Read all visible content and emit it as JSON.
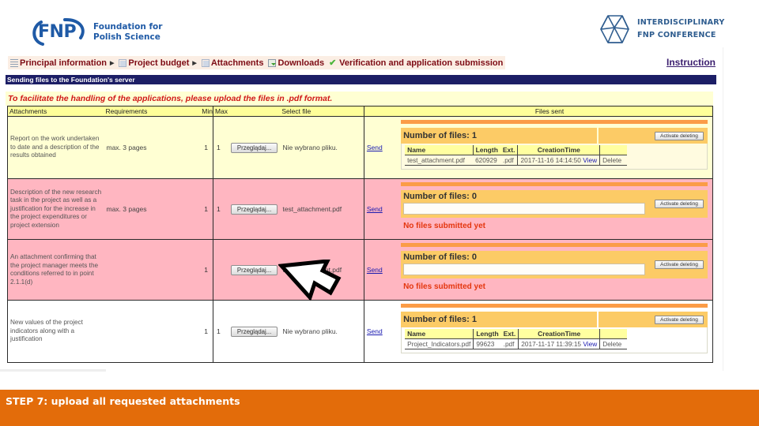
{
  "header": {
    "fnp_logo_abbr": "FNP",
    "fnp_logo_line1": "Foundation for",
    "fnp_logo_line2": "Polish Science",
    "conf_logo_line1": "INTERDISCIPLINARY",
    "conf_logo_line2": "FNP CONFERENCE"
  },
  "nav": {
    "items": [
      {
        "label": "Principal information",
        "icon": "list-icon",
        "has_arrow": true
      },
      {
        "label": "Project budget",
        "icon": "document-icon",
        "has_arrow": true
      },
      {
        "label": "Attachments",
        "icon": "document-icon",
        "has_arrow": false
      },
      {
        "label": "Downloads",
        "icon": "download-icon",
        "has_arrow": false
      },
      {
        "label": "Verification and application submission",
        "icon": "checkmark-icon",
        "has_arrow": false
      }
    ],
    "instruction_link": "Instruction"
  },
  "section_title": "Sending files to the Foundation's server",
  "notice": "To facilitate the handling of the applications, please upload the files in .pdf format.",
  "table": {
    "headers": {
      "attachments": "Attachments",
      "requirements": "Requirements",
      "min": "Min",
      "max": "Max",
      "select_file": "Select file",
      "files_sent": "Files sent"
    },
    "browse_label": "Przeglądaj...",
    "send_label": "Send",
    "rows": [
      {
        "description": "Report on the work undertaken to date and a description of the results obtained",
        "requirements": "max. 3 pages",
        "min": "1",
        "max": "1",
        "selected_file": "Nie wybrano pliku.",
        "number_of_files": "Number of files: 1",
        "files": [
          {
            "name": "test_attachment.pdf",
            "length": "620929",
            "ext": ".pdf",
            "creation_time": "2017-11-16 14:14:50",
            "view": "View",
            "delete": "Delete"
          }
        ]
      },
      {
        "description": "Description of the new research task in the project as well as a justification for the increase in the project expenditures or project extension",
        "requirements": "max. 3 pages",
        "min": "1",
        "max": "1",
        "selected_file": "test_attachment.pdf",
        "number_of_files": "Number of files: 0",
        "no_files_text": "No files submitted yet"
      },
      {
        "description": "An attachment confirming that the project manager meets the conditions referred to in point 2.1.1(d)",
        "requirements": "",
        "min": "1",
        "max": "",
        "selected_file": "test_attachment.pdf",
        "number_of_files": "Number of files: 0",
        "no_files_text": "No files submitted yet"
      },
      {
        "description": "New values of the project indicators along with a justification",
        "requirements": "",
        "min": "1",
        "max": "1",
        "selected_file": "Nie wybrano pliku.",
        "number_of_files": "Number of files: 1",
        "files": [
          {
            "name": "Project_Indicators.pdf",
            "length": "99623",
            "ext": ".pdf",
            "creation_time": "2017-11-17 11:39:15",
            "view": "View",
            "delete": "Delete"
          }
        ]
      }
    ],
    "file_columns": {
      "name": "Name",
      "length": "Length",
      "ext": "Ext.",
      "creation_time": "CreationTime"
    },
    "activate_deleting_label": "Activate deleting"
  },
  "footer": {
    "caption": "STEP 7: upload all requested attachments"
  },
  "colors": {
    "brand_blue": "#1f5aa6",
    "title_bar": "#1c1e66",
    "footer_orange": "#e36c0a",
    "row_yellow": "#ffffd3",
    "row_pink": "#ffb6c1",
    "files_header": "#fccb66",
    "orange_bar": "#fb9c47",
    "error_red": "#e4360e"
  }
}
